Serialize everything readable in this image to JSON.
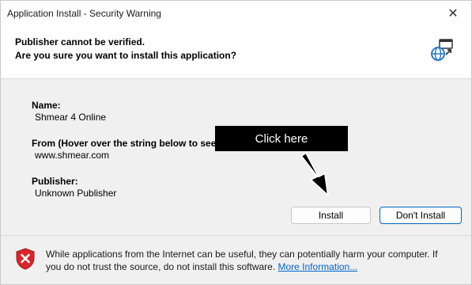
{
  "window": {
    "title": "Application Install - Security Warning",
    "close_glyph": "✕"
  },
  "header": {
    "line1": "Publisher cannot be verified.",
    "line2": "Are you sure you want to install this application?",
    "icon": "globe-install-icon"
  },
  "details": {
    "name_label": "Name:",
    "name_value": "Shmear 4 Online",
    "from_label": "From (Hover over the string below to see",
    "from_value": "www.shmear.com",
    "publisher_label": "Publisher:",
    "publisher_value": "Unknown Publisher"
  },
  "annotation": {
    "banner_text": "Click here",
    "icon": "arrow-pointer-icon"
  },
  "buttons": {
    "install": "Install",
    "dont_install": "Don't Install"
  },
  "warning": {
    "icon": "shield-error-icon",
    "text": "While applications from the Internet can be useful, they can potentially harm your computer. If you do not trust the source, do not install this software.",
    "link": "More Information..."
  },
  "colors": {
    "accent": "#0067c0",
    "link": "#0066cc",
    "warning_red": "#d9262b"
  }
}
